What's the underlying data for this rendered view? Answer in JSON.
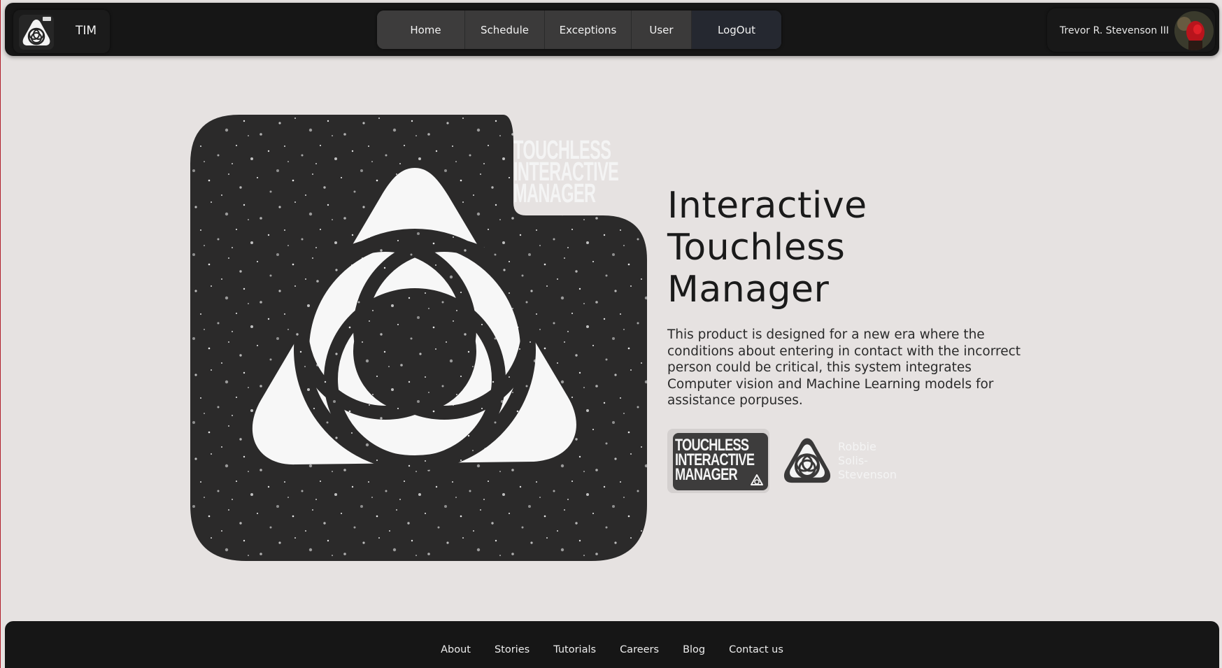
{
  "header": {
    "brand_name": "TIM",
    "nav": [
      {
        "label": "Home"
      },
      {
        "label": "Schedule"
      },
      {
        "label": "Exceptions"
      },
      {
        "label": "User"
      },
      {
        "label": "LogOut"
      }
    ],
    "user_name": "Trevor R. Stevenson III"
  },
  "hero": {
    "art_caption_lines": [
      "TOUCHLESS",
      "INTERACTIVE",
      "MANAGER"
    ],
    "title_lines": [
      "Interactive",
      "Touchless",
      "Manager"
    ],
    "description": "This product is designed for a new era where the conditions about entering in contact with the incorrect person could be critical, this system integrates Computer vision and Machine Learning models for assistance porpuses.",
    "card_text_lines": [
      "TOUCHLESS",
      "INTERACTIVE",
      "MANAGER"
    ],
    "author_name": "Robbie Solis-Stevenson"
  },
  "footer": {
    "links": [
      {
        "label": "About"
      },
      {
        "label": "Stories"
      },
      {
        "label": "Tutorials"
      },
      {
        "label": "Careers"
      },
      {
        "label": "Blog"
      },
      {
        "label": "Contact us"
      }
    ]
  },
  "colors": {
    "page_bg": "#e6e2e1",
    "bar_bg": "#161616",
    "art_bg": "#2b2a2a",
    "text_dark": "#1a1a1a"
  },
  "icons": [
    "tim-logo-icon",
    "user-avatar",
    "triangle-logo-icon"
  ]
}
